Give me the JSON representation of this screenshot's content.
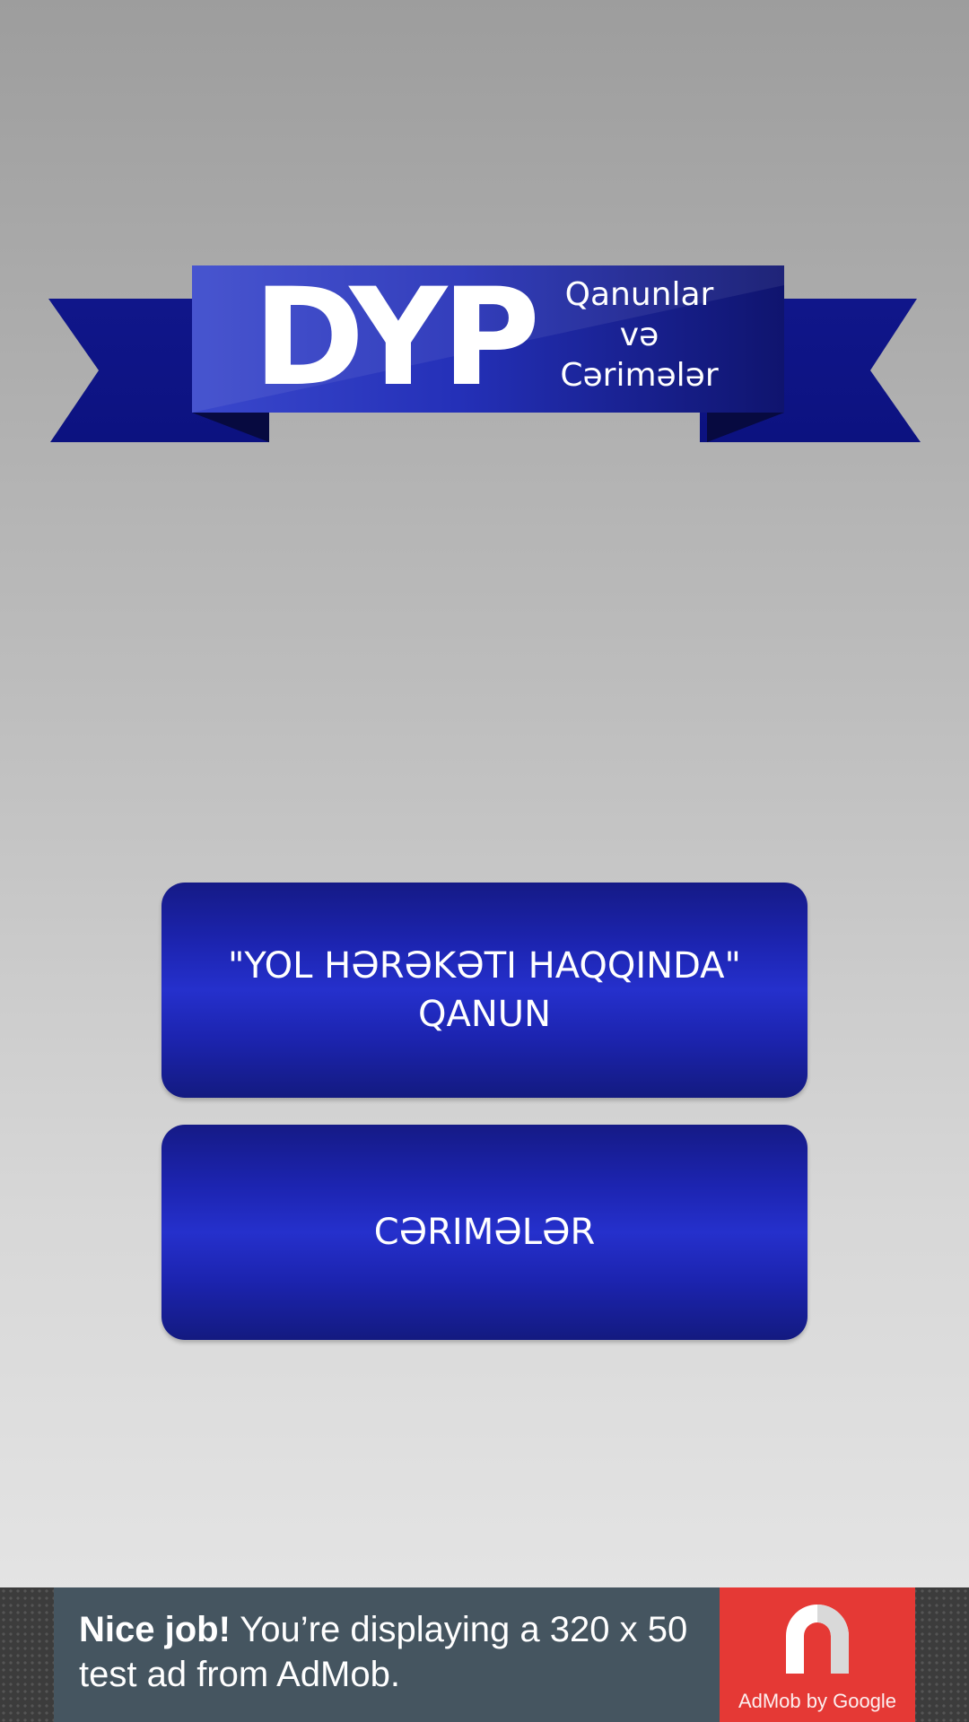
{
  "banner": {
    "title": "DYP",
    "subtitle_lines": [
      "Qanunlar",
      "və",
      "Cərimələr"
    ]
  },
  "buttons": {
    "law": "\"YOL HƏRƏKƏTI HAQQINDA\" QANUN",
    "fines": "CƏRIMƏLƏR"
  },
  "ad": {
    "headline": "Nice job!",
    "body": " You’re displaying a 320 x 50 test ad from AdMob.",
    "logo_caption": "AdMob by Google"
  },
  "colors": {
    "ribbon_blue": "#1c24b0",
    "button_blue": "#2530cc",
    "ad_background": "#455560",
    "ad_logo_red": "#e53935"
  },
  "icons": {
    "ad_logo": "admob-logo-icon"
  }
}
